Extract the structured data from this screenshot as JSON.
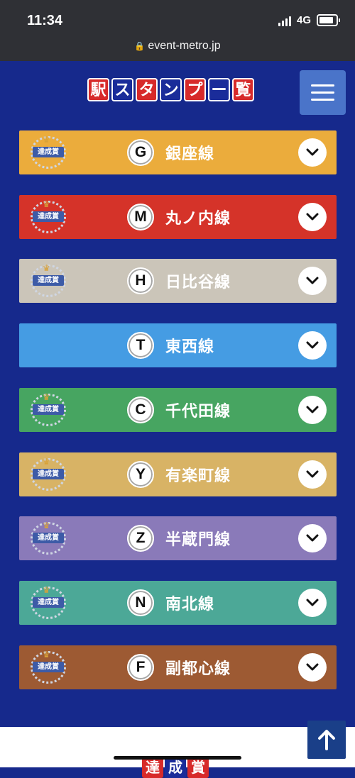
{
  "status": {
    "time": "11:34",
    "network": "4G"
  },
  "browser": {
    "url": "event-metro.jp"
  },
  "header": {
    "title_chars": [
      "駅",
      "ス",
      "タ",
      "ン",
      "プ",
      "ー",
      "覧"
    ]
  },
  "badge_label": "達成賞",
  "lines": [
    {
      "symbol": "G",
      "name": "銀座線",
      "color": "#ebac3c",
      "badge": true
    },
    {
      "symbol": "M",
      "name": "丸ノ内線",
      "color": "#d53329",
      "badge": true
    },
    {
      "symbol": "H",
      "name": "日比谷線",
      "color": "#cbc5b9",
      "badge": true
    },
    {
      "symbol": "T",
      "name": "東西線",
      "color": "#459ce3",
      "badge": false
    },
    {
      "symbol": "C",
      "name": "千代田線",
      "color": "#47a561",
      "badge": true
    },
    {
      "symbol": "Y",
      "name": "有楽町線",
      "color": "#d8b365",
      "badge": true
    },
    {
      "symbol": "Z",
      "name": "半蔵門線",
      "color": "#8a7ab9",
      "badge": true
    },
    {
      "symbol": "N",
      "name": "南北線",
      "color": "#4ca897",
      "badge": true
    },
    {
      "symbol": "F",
      "name": "副都心線",
      "color": "#9d5a33",
      "badge": true
    }
  ],
  "footer": {
    "peek_chars": [
      "達",
      "成",
      "賞"
    ]
  },
  "colors": {
    "page_bg": "#16298c",
    "title_red": "#d72a2a",
    "title_blue": "#1a2c9a",
    "menu_bg": "#4a74c9",
    "scroll_top_bg": "#1a3f88"
  }
}
